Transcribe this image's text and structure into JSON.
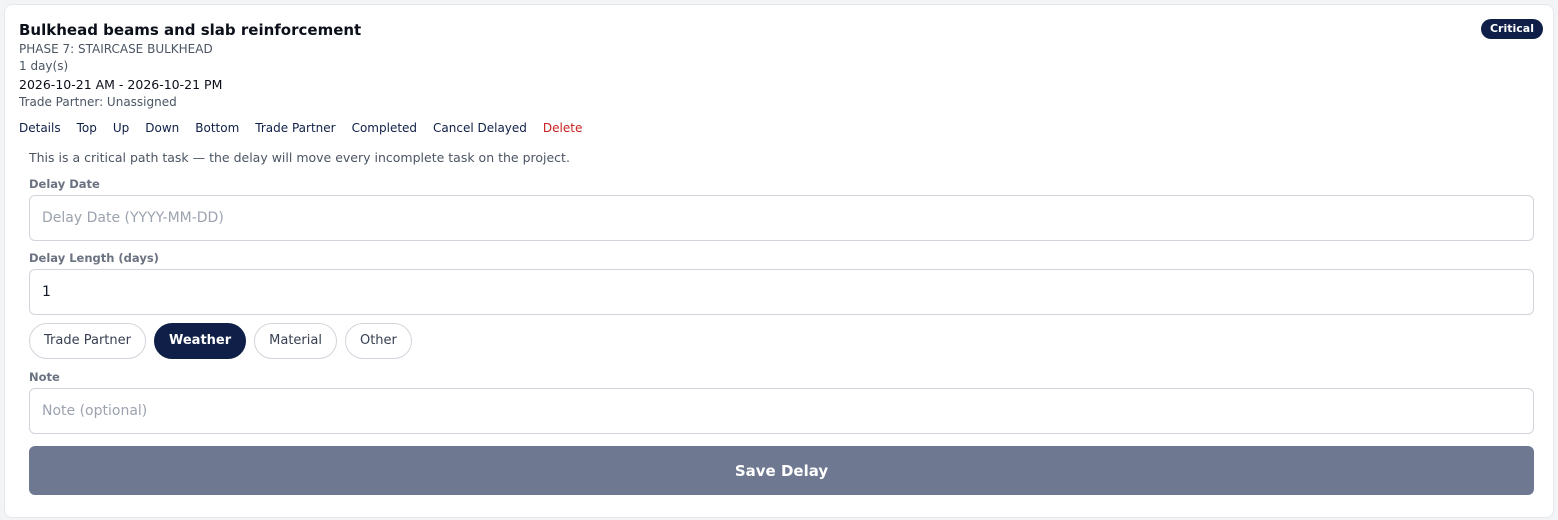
{
  "task": {
    "title": "Bulkhead beams and slab reinforcement",
    "phase": "PHASE 7: STAIRCASE BULKHEAD",
    "duration": "1 day(s)",
    "dates": "2026-10-21 AM - 2026-10-21 PM",
    "trade_partner": "Trade Partner: Unassigned",
    "badge": "Critical"
  },
  "actions": [
    "Details",
    "Top",
    "Up",
    "Down",
    "Bottom",
    "Trade Partner",
    "Completed",
    "Cancel Delayed",
    "Delete"
  ],
  "form": {
    "notice": "This is a critical path task — the delay will move every incomplete task on the project.",
    "delay_date_label": "Delay Date",
    "delay_date_placeholder": "Delay Date (YYYY-MM-DD)",
    "delay_length_label": "Delay Length (days)",
    "delay_length_value": "1",
    "reasons": [
      "Trade Partner",
      "Weather",
      "Material",
      "Other"
    ],
    "selected_reason": "Weather",
    "note_label": "Note",
    "note_placeholder": "Note (optional)",
    "save_label": "Save Delay"
  },
  "colors": {
    "accent": "#0f1f47",
    "danger": "#c81e1e",
    "save_button": "#6e7891"
  }
}
